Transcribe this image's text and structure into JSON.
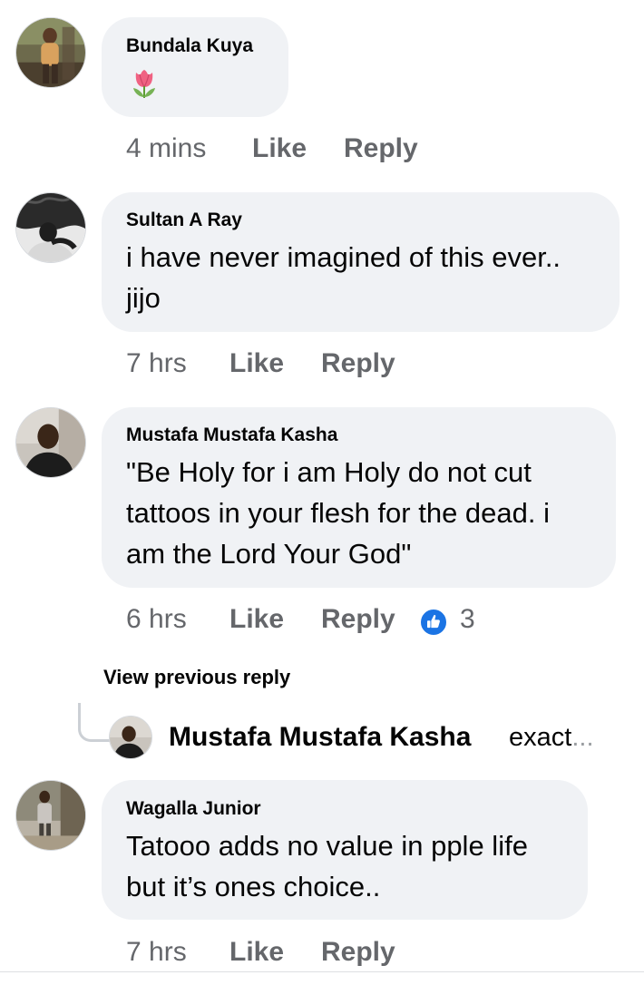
{
  "comments": [
    {
      "author": "Bundala Kuya",
      "text_lines": [],
      "emoji": "tulip",
      "time": "4 mins",
      "like_label": "Like",
      "reply_label": "Reply"
    },
    {
      "author": "Sultan A Ray",
      "text_lines": [
        "i have never imagined of this ever..",
        "jijo"
      ],
      "time": "7 hrs",
      "like_label": "Like",
      "reply_label": "Reply"
    },
    {
      "author": "Mustafa Mustafa Kasha",
      "text_lines": [
        "\"Be Holy for i am Holy do not cut",
        "tattoos in your flesh for the dead. i",
        "am the Lord Your God\""
      ],
      "time": "6 hrs",
      "like_label": "Like",
      "reply_label": "Reply",
      "reaction_count": "3"
    },
    {
      "author": "Wagalla Junior",
      "text_lines": [
        "Tatooo adds no value in pple life",
        "but it’s ones choice.."
      ],
      "time": "7 hrs",
      "like_label": "Like",
      "reply_label": "Reply"
    }
  ],
  "view_previous_reply": "View previous reply",
  "reply_preview": {
    "author": "Mustafa Mustafa Kasha",
    "snippet": "exact",
    "ellipsis": "..."
  },
  "colors": {
    "bubble": "#f0f2f5",
    "meta_text": "#65676b",
    "like_blue": "#1b74e4"
  },
  "icons": {
    "reaction": "like-thumb-icon",
    "emoji": "tulip-emoji-icon"
  }
}
